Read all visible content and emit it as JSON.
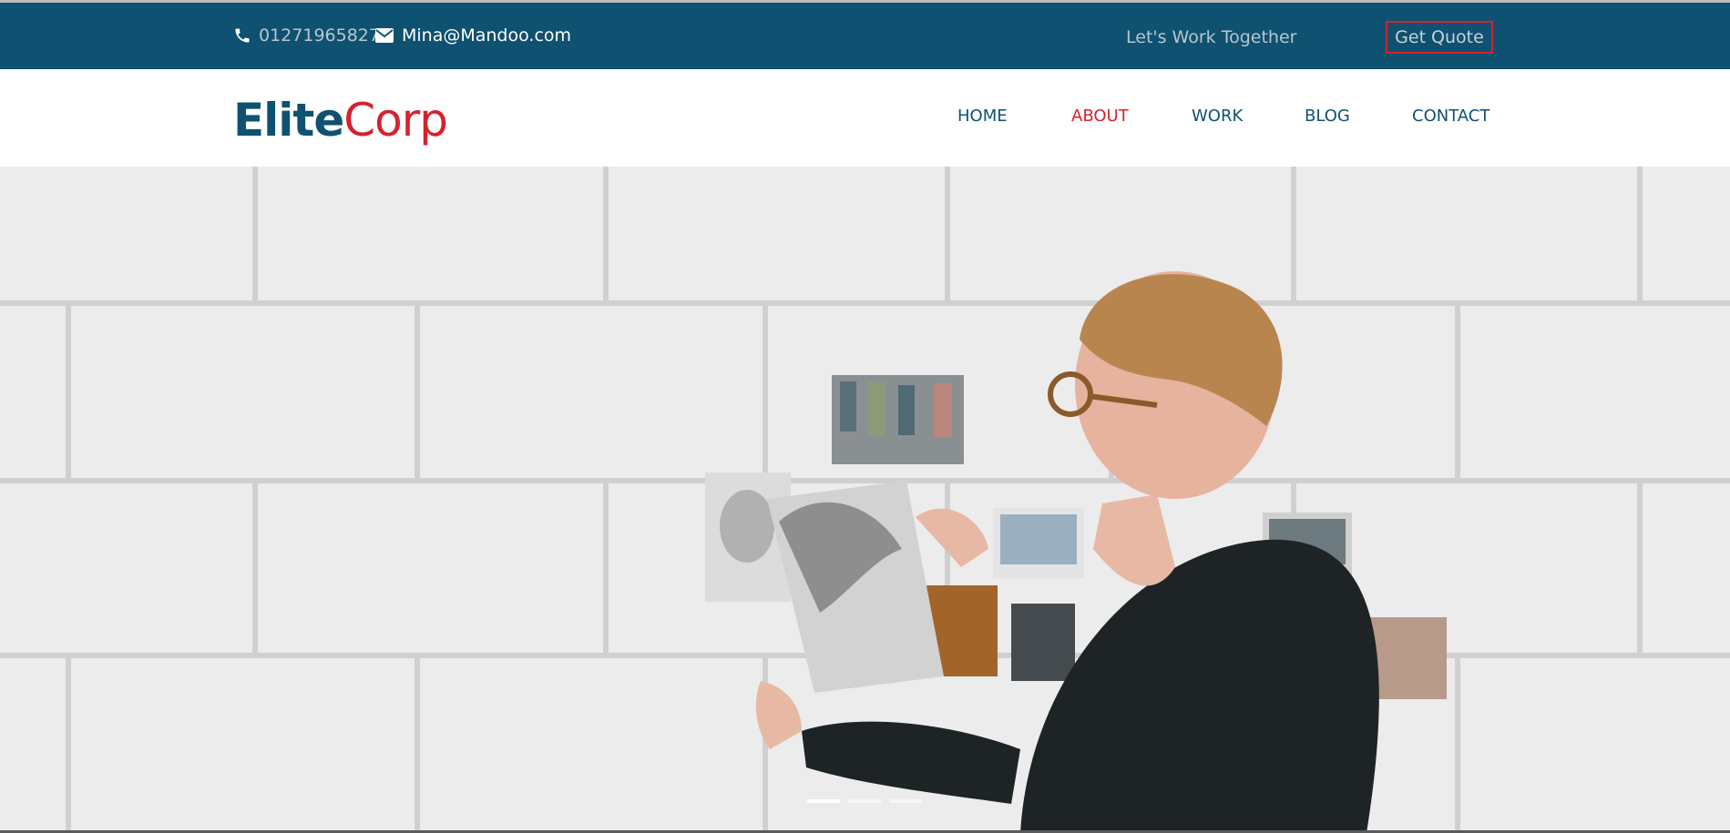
{
  "topbar": {
    "phone": "01271965827",
    "email": "Mina@Mandoo.com",
    "tagline": "Let's Work Together",
    "quote_label": "Get Quote",
    "phone_icon": "phone-icon",
    "email_icon": "envelope-icon"
  },
  "header": {
    "logo_part1": "Elite",
    "logo_part2": "Corp",
    "nav": [
      {
        "label": "HOME",
        "active": false
      },
      {
        "label": "ABOUT",
        "active": true
      },
      {
        "label": "WORK",
        "active": false
      },
      {
        "label": "BLOG",
        "active": false
      },
      {
        "label": "CONTACT",
        "active": false
      }
    ]
  },
  "hero": {
    "slide_count": 3,
    "active_slide": 1
  },
  "colors": {
    "primary": "#0e5170",
    "accent": "#d6222e"
  }
}
